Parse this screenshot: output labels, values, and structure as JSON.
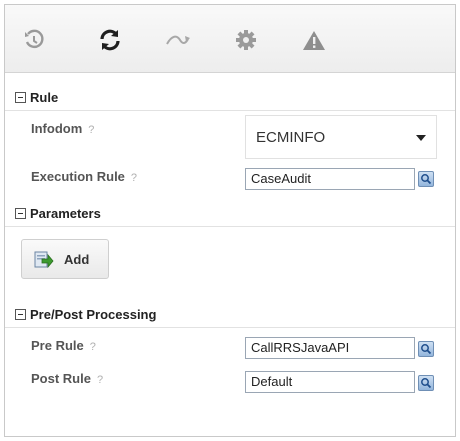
{
  "toolbar": {
    "icons": [
      "history-icon",
      "refresh-icon",
      "curve-icon",
      "gear-icon",
      "warning-icon"
    ],
    "accent": "#8a8a8a",
    "active": "#1f1f1f"
  },
  "rule_section": {
    "title": "Rule",
    "infodom_label": "Infodom",
    "infodom_help": "?",
    "infodom_value": "ECMINFO",
    "execution_rule_label": "Execution Rule",
    "execution_rule_help": "?",
    "execution_rule_value": "CaseAudit"
  },
  "parameters_section": {
    "title": "Parameters",
    "add_label": "Add"
  },
  "processing_section": {
    "title": "Pre/Post Processing",
    "pre_rule_label": "Pre Rule",
    "pre_rule_help": "?",
    "pre_rule_value": "CallRRSJavaAPI",
    "post_rule_label": "Post Rule",
    "post_rule_help": "?",
    "post_rule_value": "Default"
  }
}
